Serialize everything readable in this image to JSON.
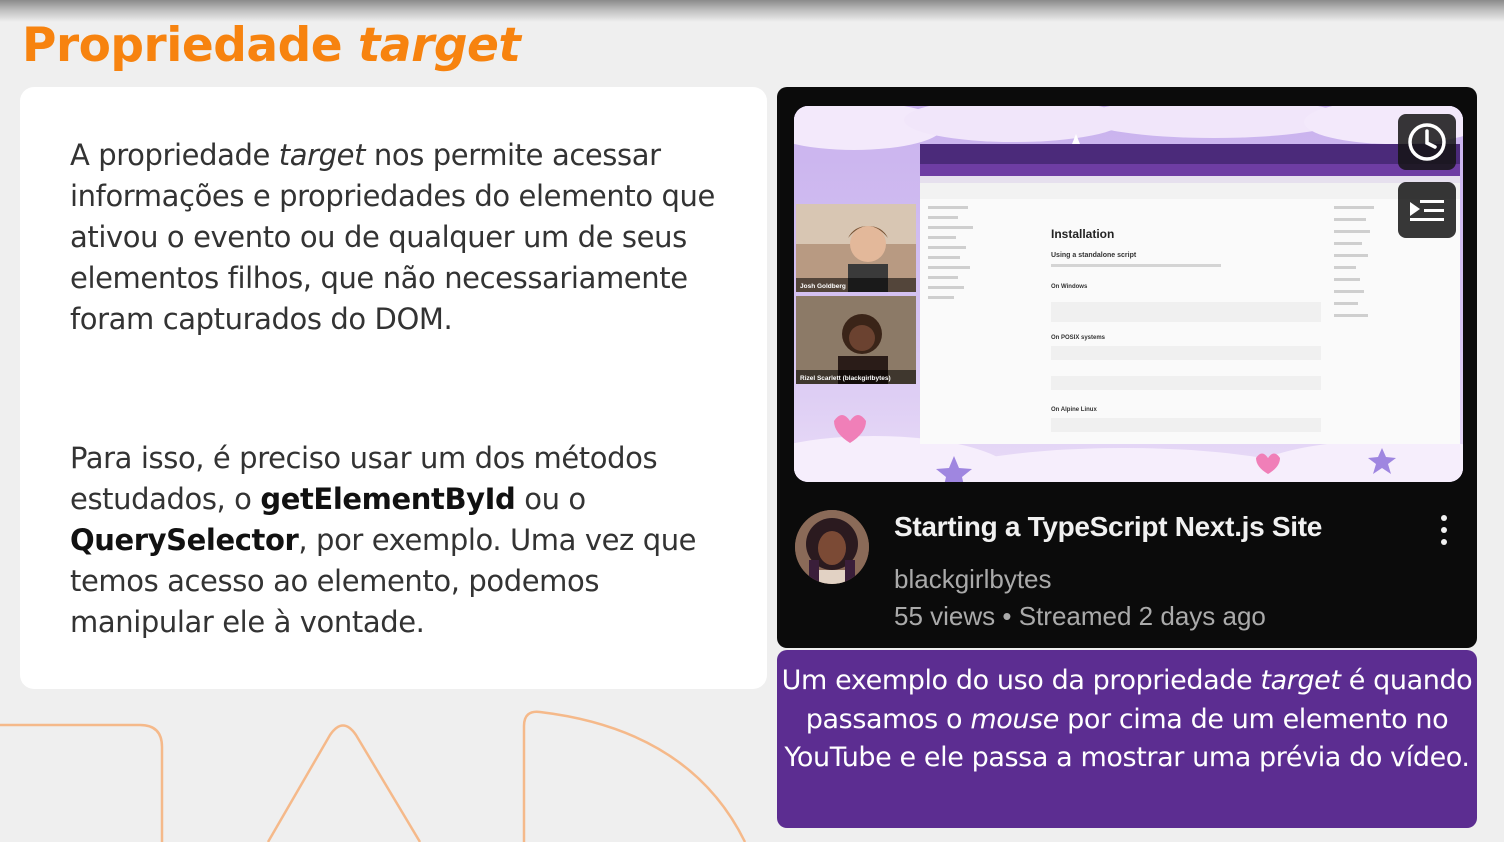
{
  "slide": {
    "title_plain": "Propriedade ",
    "title_italic": "target"
  },
  "left_card": {
    "p1": {
      "t1": "A propriedade ",
      "t2_italic": "target",
      "t3": " nos permite acessar informações e propriedades do elemento que ativou o evento ou de qualquer um de seus elementos filhos, que não necessariamente foram capturados do DOM."
    },
    "p2": {
      "t1": "Para isso, é preciso usar um dos métodos estudados, o ",
      "t2_bold": "getElementById",
      "t3": " ou o ",
      "t4_bold": "QuerySelector",
      "t5": ", por exemplo. Uma vez que temos acesso ao elemento, podemos manipular ele à vontade."
    }
  },
  "video": {
    "title": "Starting a TypeScript Next.js Site",
    "channel": "blackgirlbytes",
    "views": "55 views",
    "separator": "•",
    "streamed": "Streamed 2 days ago",
    "watch_later_icon": "clock-icon",
    "add_queue_icon": "queue-icon",
    "more_icon": "more-vert-icon",
    "thumbnail": {
      "doc_heading": "Installation",
      "doc_subheading": "Using a standalone script",
      "section_windows": "On Windows",
      "section_posix": "On POSIX systems",
      "section_alpine": "On Alpine Linux",
      "person1_name": "Josh Goldberg",
      "person2_name": "Rizel Scarlett (blackgirlbytes)"
    }
  },
  "caption": {
    "t1": "Um exemplo do uso da propriedade ",
    "t2_italic": "target",
    "t3": " é quando passamos o ",
    "t4_italic": "mouse",
    "t5": " por cima de um elemento no YouTube e ele passa a mostrar uma prévia do vídeo."
  },
  "colors": {
    "accent_orange": "#f7830f",
    "caption_purple": "#5c2d91",
    "video_bg": "#0b0b0b"
  }
}
